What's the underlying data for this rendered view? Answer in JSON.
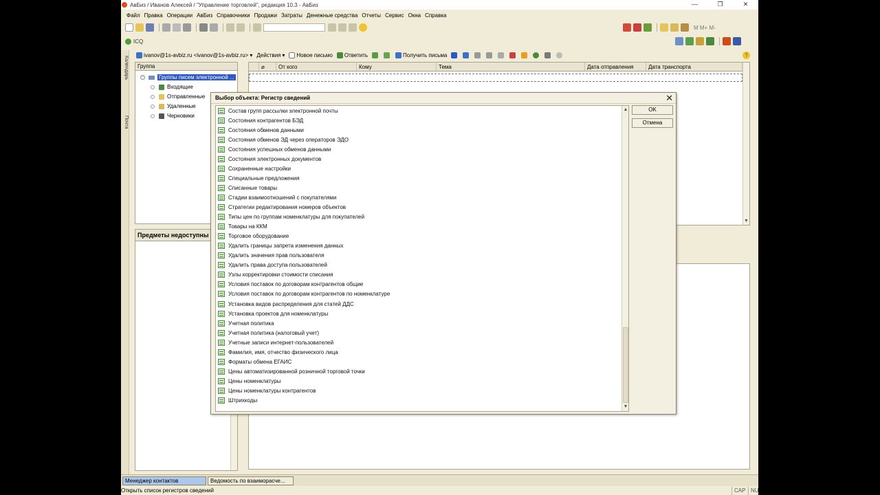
{
  "window": {
    "title": "АвБиз / Иванов Алексей / \"Управление торговлей\", редакция 10.3 - АвБиз",
    "controls": [
      "—",
      "❐",
      "✕"
    ]
  },
  "menu": [
    "Файл",
    "Правка",
    "Операции",
    "АвБиз",
    "Справочники",
    "Продажи",
    "Затраты",
    "Денежные средства",
    "Отчеты",
    "Сервис",
    "Окна",
    "Справка"
  ],
  "toolbar2": {
    "icq_label": "ICQ"
  },
  "right_toolbar_text": "М  М+  М-",
  "side_tabs": [
    "Календарь",
    "Почта"
  ],
  "mail_toolbar": {
    "account": "ivanov@1s-avbiz.ru <ivanov@1s-avbiz.ru>",
    "actions": "Действия",
    "new_letter": "Новое письмо",
    "reply": "Ответить",
    "receive": "Получить письма"
  },
  "group_panel": {
    "header": "Группа",
    "root": "Группы писем электронной ...",
    "items": [
      "Входящие",
      "Отправленные",
      "Удаленные",
      "Черновики"
    ]
  },
  "subjects_panel": {
    "header": "Предметы недоступны"
  },
  "mail_grid": {
    "columns": [
      "",
      "",
      "От кого",
      "Кому",
      "Тема",
      "Дата отправления",
      "Дата транспорта"
    ]
  },
  "dialog": {
    "title": "Выбор объекта: Регистр сведений",
    "ok": "OK",
    "cancel": "Отмена",
    "items": [
      "Состав групп рассылки электронной почты",
      "Состояния контрагентов БЭД",
      "Состояния обменов данными",
      "Состояния обменов ЭД через операторов ЭДО",
      "Состояния успешных обменов данными",
      "Состояния электронных документов",
      "Сохраненные настройки",
      "Специальные предложения",
      "Списанные товары",
      "Стадии взаимоотношений с покупателями",
      "Стратегии редактирования номеров объектов",
      "Типы цен по группам номенклатуры для покупателей",
      "Товары на ККМ",
      "Торговое оборудование",
      "Удалить границы запрета изменения данных",
      "Удалить значения прав пользователя",
      "Удалить права доступа пользователей",
      "Узлы корректировки стоимости списания",
      "Условия поставок по договорам контрагентов общие",
      "Условия поставок по договорам контрагентов по номенклатуре",
      "Установка видов распределения для статей ДДС",
      "Установка проектов для номенклатуры",
      "Учетная политика",
      "Учетная политика (налоговый учет)",
      "Учетные записи интернет-пользователей",
      "Фамилия, имя, отчество физического лица",
      "Форматы обмена ЕГАИС",
      "Цены автоматизированной розничной торговой точки",
      "Цены номенклатуры",
      "Цены номенклатуры контрагентов",
      "Штрихкоды"
    ]
  },
  "taskbar": {
    "tasks": [
      "Менеджер контактов",
      "Ведомость по взаиморасче..."
    ]
  },
  "status": {
    "text": "Открыть список регистров сведений",
    "indicators": [
      "CAP",
      "NU"
    ]
  }
}
